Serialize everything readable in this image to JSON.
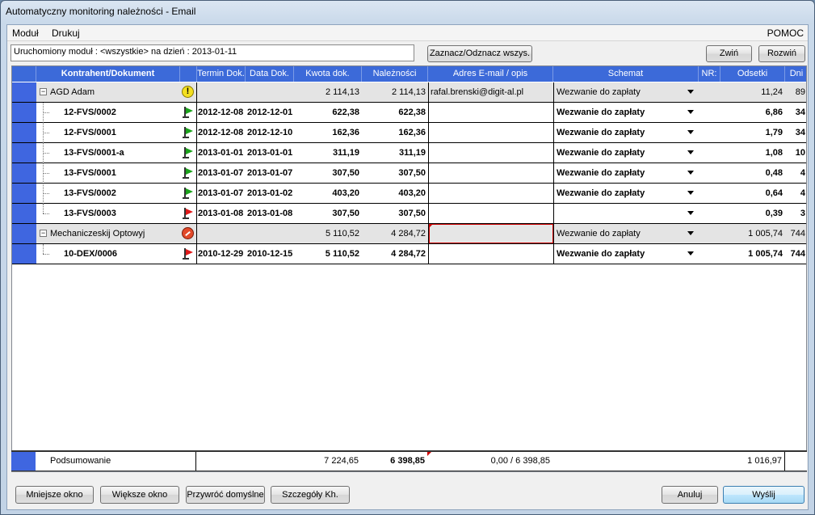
{
  "window": {
    "title": "Automatyczny monitoring należności - Email"
  },
  "menu": {
    "items": [
      "Moduł",
      "Drukuj"
    ],
    "help": "POMOC"
  },
  "toolbar": {
    "status_text": "Uruchomiony moduł : <wszystkie>  na dzień : 2013-01-11",
    "select_all_label": "Zaznacz/Odznacz wszys.",
    "collapse_label": "Zwiń",
    "expand_label": "Rozwiń"
  },
  "table": {
    "columns": [
      "Kontrahent/Dokument",
      "Termin Dok.",
      "Data Dok.",
      "Kwota dok.",
      "Należności",
      "Adres E-mail / opis",
      "Schemat",
      "NR:",
      "Odsetki",
      "Dni"
    ],
    "rows": [
      {
        "type": "group",
        "name": "AGD Adam",
        "icon": "warning-icon",
        "termin": "",
        "data": "",
        "kwota": "2 114,13",
        "naleznosci": "2 114,13",
        "email": "rafal.brenski@digit-al.pl",
        "schemat": "Wezwanie do zapłaty",
        "nr": "",
        "odsetki": "11,24",
        "dni": "89"
      },
      {
        "type": "doc",
        "name": "12-FVS/0002",
        "icon": "green-flag-icon",
        "termin": "2012-12-08",
        "data": "2012-12-01",
        "kwota": "622,38",
        "naleznosci": "622,38",
        "email": "",
        "schemat": "Wezwanie do zapłaty",
        "nr": "",
        "odsetki": "6,86",
        "dni": "34"
      },
      {
        "type": "doc",
        "name": "12-FVS/0001",
        "icon": "green-flag-icon",
        "termin": "2012-12-08",
        "data": "2012-12-10",
        "kwota": "162,36",
        "naleznosci": "162,36",
        "email": "",
        "schemat": "Wezwanie do zapłaty",
        "nr": "",
        "odsetki": "1,79",
        "dni": "34"
      },
      {
        "type": "doc",
        "name": "13-FVS/0001-a",
        "icon": "green-flag-icon",
        "termin": "2013-01-01",
        "data": "2013-01-01",
        "kwota": "311,19",
        "naleznosci": "311,19",
        "email": "",
        "schemat": "Wezwanie do zapłaty",
        "nr": "",
        "odsetki": "1,08",
        "dni": "10"
      },
      {
        "type": "doc",
        "name": "13-FVS/0001",
        "icon": "green-flag-icon",
        "termin": "2013-01-07",
        "data": "2013-01-07",
        "kwota": "307,50",
        "naleznosci": "307,50",
        "email": "",
        "schemat": "Wezwanie do zapłaty",
        "nr": "",
        "odsetki": "0,48",
        "dni": "4"
      },
      {
        "type": "doc",
        "name": "13-FVS/0002",
        "icon": "green-flag-icon",
        "termin": "2013-01-07",
        "data": "2013-01-02",
        "kwota": "403,20",
        "naleznosci": "403,20",
        "email": "",
        "schemat": "Wezwanie do zapłaty",
        "nr": "",
        "odsetki": "0,64",
        "dni": "4"
      },
      {
        "type": "doc",
        "name": "13-FVS/0003",
        "icon": "red-flag-icon",
        "termin": "2013-01-08",
        "data": "2013-01-08",
        "kwota": "307,50",
        "naleznosci": "307,50",
        "email": "",
        "schemat": "",
        "nr": "",
        "odsetki": "0,39",
        "dni": "3"
      },
      {
        "type": "group",
        "name": "Mechaniczeskij Optowyj",
        "icon": "blocked-icon",
        "termin": "",
        "data": "",
        "kwota": "5 110,52",
        "naleznosci": "4 284,72",
        "email": "",
        "schemat": "Wezwanie do zapłaty",
        "nr": "",
        "odsetki": "1 005,74",
        "dni": "744"
      },
      {
        "type": "doc",
        "name": "10-DEX/0006",
        "icon": "red-flag-icon",
        "termin": "2010-12-29",
        "data": "2010-12-15",
        "kwota": "5 110,52",
        "naleznosci": "4 284,72",
        "email": "",
        "schemat": "Wezwanie do zapłaty",
        "nr": "",
        "odsetki": "1 005,74",
        "dni": "744"
      }
    ],
    "summary": {
      "label": "Podsumowanie",
      "kwota": "7 224,65",
      "naleznosci": "6 398,85",
      "email": "0,00 / 6 398,85",
      "odsetki": "1 016,97"
    }
  },
  "footer": {
    "smaller_label": "Mniejsze okno",
    "bigger_label": "Większe okno",
    "restore_label": "Przywróć domyślne",
    "details_label": "Szczegóły Kh.",
    "cancel_label": "Anuluj",
    "send_label": "Wyślij"
  }
}
